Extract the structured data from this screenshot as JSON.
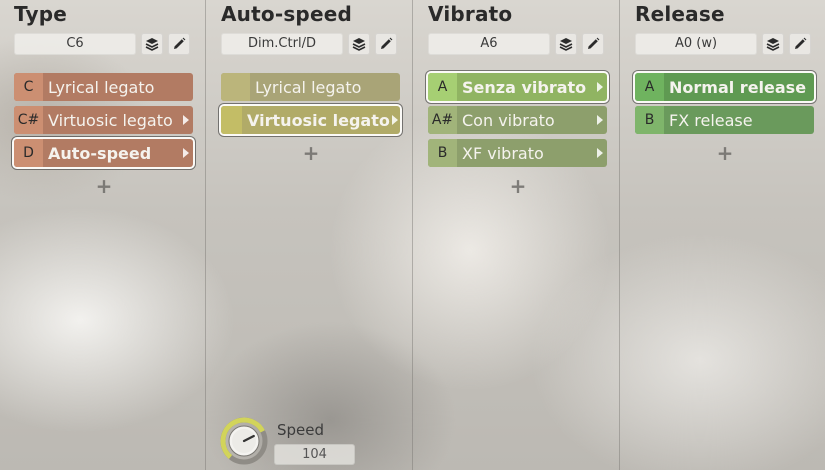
{
  "columns": [
    {
      "title": "Type",
      "field": "C6",
      "items": [
        {
          "key": "C",
          "label": "Lyrical legato",
          "selected": false,
          "submenu": false
        },
        {
          "key": "C#",
          "label": "Virtuosic legato",
          "selected": false,
          "submenu": true
        },
        {
          "key": "D",
          "label": "Auto-speed",
          "selected": true,
          "submenu": true
        }
      ]
    },
    {
      "title": "Auto-speed",
      "field": "Dim.Ctrl/D",
      "items": [
        {
          "key": "",
          "label": "Lyrical legato",
          "selected": false,
          "submenu": false
        },
        {
          "key": "",
          "label": "Virtuosic legato",
          "selected": true,
          "submenu": true
        }
      ]
    },
    {
      "title": "Vibrato",
      "field": "A6",
      "items": [
        {
          "key": "A",
          "label": "Senza vibrato",
          "selected": true,
          "submenu": true
        },
        {
          "key": "A#",
          "label": "Con vibrato",
          "selected": false,
          "submenu": true
        },
        {
          "key": "B",
          "label": "XF vibrato",
          "selected": false,
          "submenu": true
        }
      ]
    },
    {
      "title": "Release",
      "field": "A0 (w)",
      "items": [
        {
          "key": "A",
          "label": "Normal release",
          "selected": true,
          "submenu": false
        },
        {
          "key": "B",
          "label": "FX release",
          "selected": false,
          "submenu": false
        }
      ]
    }
  ],
  "add_symbol": "+",
  "speed": {
    "label": "Speed",
    "value": "104",
    "knob_level": 0.78
  },
  "icons": {
    "layers": "layers-icon",
    "edit": "pencil-icon",
    "submenu": "triangle-right-icon",
    "add": "plus-icon"
  },
  "colors": {
    "knob_ring": "#d2d45a",
    "type_item": "#b27b63",
    "autospeed_item": "#a9a477",
    "vibrato_item": "#8d9f6c",
    "release_item": "#6a9a5c"
  }
}
